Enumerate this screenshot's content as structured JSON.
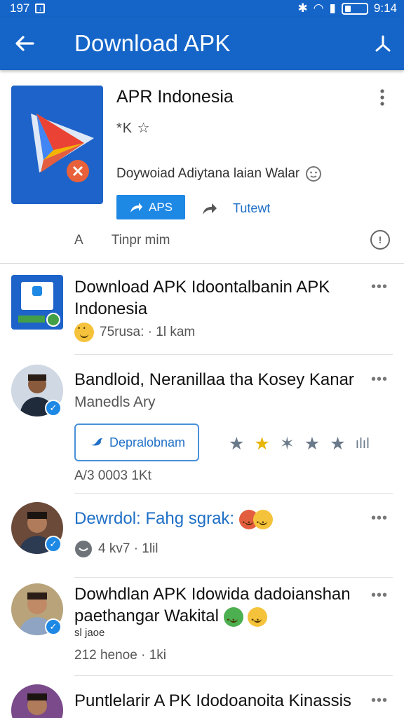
{
  "status_bar": {
    "time_left": "197",
    "time_right": "9:14"
  },
  "app_bar": {
    "title": "Download APK"
  },
  "app": {
    "name": "APR Indonesia",
    "rating": "*K ☆",
    "description": "Doywoiad Adiytana laian Walar",
    "apk_button": "APS",
    "tweet_button": "Tutewt",
    "meta_a": "A",
    "meta_b": "Tinpr  mim"
  },
  "items": [
    {
      "title": "Download APK Idoontalbanin APK Indonesia",
      "meta": "75rusa: · 1l kam"
    },
    {
      "title": "Bandloid, Neranillaa tha Kosey Kanar",
      "subtitle": "Manedls Ary",
      "button": "Depralobnam",
      "meta": "A/3  0003   1Kt"
    },
    {
      "title": "Dewrdol: Fahg sgrak:",
      "meta": "4 kv7 · 1lil"
    },
    {
      "title": "Dowhdlan APK Idowida dadoianshan paethangar Wakital",
      "extra": "sl jaoe",
      "meta": "212 henoe · 1ki"
    },
    {
      "title": "Puntlelarir A PK Idodoanoita Kinassis"
    }
  ],
  "colors": {
    "primary": "#1565c8",
    "accent": "#1e88e5",
    "link": "#1f6fc6"
  }
}
